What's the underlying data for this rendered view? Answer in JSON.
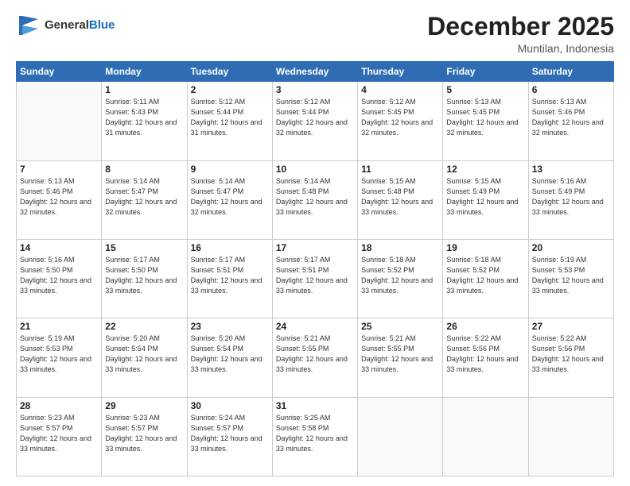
{
  "header": {
    "logo_general": "General",
    "logo_blue": "Blue",
    "title": "December 2025",
    "subtitle": "Muntilan, Indonesia"
  },
  "calendar": {
    "days_of_week": [
      "Sunday",
      "Monday",
      "Tuesday",
      "Wednesday",
      "Thursday",
      "Friday",
      "Saturday"
    ],
    "weeks": [
      [
        {
          "day": "",
          "info": ""
        },
        {
          "day": "1",
          "info": "Sunrise: 5:11 AM\nSunset: 5:43 PM\nDaylight: 12 hours\nand 31 minutes."
        },
        {
          "day": "2",
          "info": "Sunrise: 5:12 AM\nSunset: 5:44 PM\nDaylight: 12 hours\nand 31 minutes."
        },
        {
          "day": "3",
          "info": "Sunrise: 5:12 AM\nSunset: 5:44 PM\nDaylight: 12 hours\nand 32 minutes."
        },
        {
          "day": "4",
          "info": "Sunrise: 5:12 AM\nSunset: 5:45 PM\nDaylight: 12 hours\nand 32 minutes."
        },
        {
          "day": "5",
          "info": "Sunrise: 5:13 AM\nSunset: 5:45 PM\nDaylight: 12 hours\nand 32 minutes."
        },
        {
          "day": "6",
          "info": "Sunrise: 5:13 AM\nSunset: 5:46 PM\nDaylight: 12 hours\nand 32 minutes."
        }
      ],
      [
        {
          "day": "7",
          "info": "Sunrise: 5:13 AM\nSunset: 5:46 PM\nDaylight: 12 hours\nand 32 minutes."
        },
        {
          "day": "8",
          "info": "Sunrise: 5:14 AM\nSunset: 5:47 PM\nDaylight: 12 hours\nand 32 minutes."
        },
        {
          "day": "9",
          "info": "Sunrise: 5:14 AM\nSunset: 5:47 PM\nDaylight: 12 hours\nand 32 minutes."
        },
        {
          "day": "10",
          "info": "Sunrise: 5:14 AM\nSunset: 5:48 PM\nDaylight: 12 hours\nand 33 minutes."
        },
        {
          "day": "11",
          "info": "Sunrise: 5:15 AM\nSunset: 5:48 PM\nDaylight: 12 hours\nand 33 minutes."
        },
        {
          "day": "12",
          "info": "Sunrise: 5:15 AM\nSunset: 5:49 PM\nDaylight: 12 hours\nand 33 minutes."
        },
        {
          "day": "13",
          "info": "Sunrise: 5:16 AM\nSunset: 5:49 PM\nDaylight: 12 hours\nand 33 minutes."
        }
      ],
      [
        {
          "day": "14",
          "info": "Sunrise: 5:16 AM\nSunset: 5:50 PM\nDaylight: 12 hours\nand 33 minutes."
        },
        {
          "day": "15",
          "info": "Sunrise: 5:17 AM\nSunset: 5:50 PM\nDaylight: 12 hours\nand 33 minutes."
        },
        {
          "day": "16",
          "info": "Sunrise: 5:17 AM\nSunset: 5:51 PM\nDaylight: 12 hours\nand 33 minutes."
        },
        {
          "day": "17",
          "info": "Sunrise: 5:17 AM\nSunset: 5:51 PM\nDaylight: 12 hours\nand 33 minutes."
        },
        {
          "day": "18",
          "info": "Sunrise: 5:18 AM\nSunset: 5:52 PM\nDaylight: 12 hours\nand 33 minutes."
        },
        {
          "day": "19",
          "info": "Sunrise: 5:18 AM\nSunset: 5:52 PM\nDaylight: 12 hours\nand 33 minutes."
        },
        {
          "day": "20",
          "info": "Sunrise: 5:19 AM\nSunset: 5:53 PM\nDaylight: 12 hours\nand 33 minutes."
        }
      ],
      [
        {
          "day": "21",
          "info": "Sunrise: 5:19 AM\nSunset: 5:53 PM\nDaylight: 12 hours\nand 33 minutes."
        },
        {
          "day": "22",
          "info": "Sunrise: 5:20 AM\nSunset: 5:54 PM\nDaylight: 12 hours\nand 33 minutes."
        },
        {
          "day": "23",
          "info": "Sunrise: 5:20 AM\nSunset: 5:54 PM\nDaylight: 12 hours\nand 33 minutes."
        },
        {
          "day": "24",
          "info": "Sunrise: 5:21 AM\nSunset: 5:55 PM\nDaylight: 12 hours\nand 33 minutes."
        },
        {
          "day": "25",
          "info": "Sunrise: 5:21 AM\nSunset: 5:55 PM\nDaylight: 12 hours\nand 33 minutes."
        },
        {
          "day": "26",
          "info": "Sunrise: 5:22 AM\nSunset: 5:56 PM\nDaylight: 12 hours\nand 33 minutes."
        },
        {
          "day": "27",
          "info": "Sunrise: 5:22 AM\nSunset: 5:56 PM\nDaylight: 12 hours\nand 33 minutes."
        }
      ],
      [
        {
          "day": "28",
          "info": "Sunrise: 5:23 AM\nSunset: 5:57 PM\nDaylight: 12 hours\nand 33 minutes."
        },
        {
          "day": "29",
          "info": "Sunrise: 5:23 AM\nSunset: 5:57 PM\nDaylight: 12 hours\nand 33 minutes."
        },
        {
          "day": "30",
          "info": "Sunrise: 5:24 AM\nSunset: 5:57 PM\nDaylight: 12 hours\nand 33 minutes."
        },
        {
          "day": "31",
          "info": "Sunrise: 5:25 AM\nSunset: 5:58 PM\nDaylight: 12 hours\nand 33 minutes."
        },
        {
          "day": "",
          "info": ""
        },
        {
          "day": "",
          "info": ""
        },
        {
          "day": "",
          "info": ""
        }
      ]
    ]
  }
}
